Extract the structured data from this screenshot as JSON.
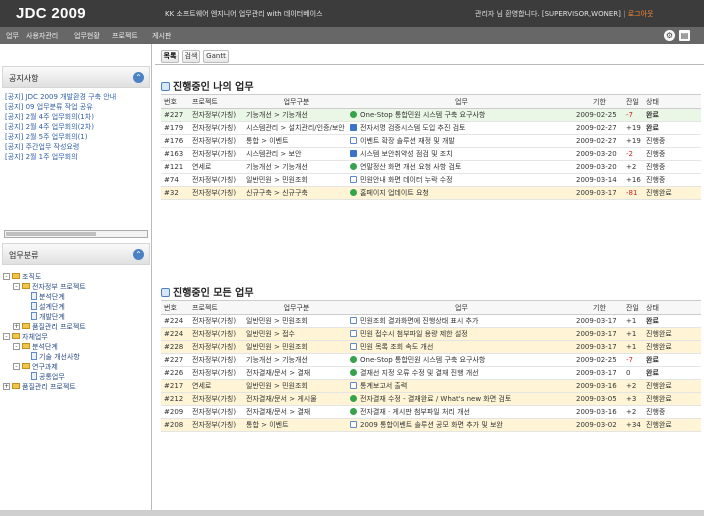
{
  "app": {
    "logo": "JDC 2009",
    "top_center": "KK 소프트웨어 엔지니어 업무관리 with 데이터베이스",
    "top_right_user": "관리자 님 환영합니다. [SUPERVISOR,WONER]",
    "top_right_link": "로그아웃"
  },
  "menu": {
    "items": [
      "업무",
      "사용자관리",
      "업무현황",
      "프로젝트",
      "게시판"
    ],
    "icons": [
      "gear-icon",
      "document-icon"
    ]
  },
  "sidebar": {
    "notice_title": "공지사항",
    "notices": [
      "[공지] JDC 2009 개발환경 구축 안내",
      "[공지] 09 업무분류 작업 공유",
      "[공지] 2월 4주 업무회의(1차)",
      "[공지] 2월 4주 업무회의(2차)",
      "[공지] 2월 5주 업무회의(1)",
      "[공지] 주간업무 작성요령",
      "[공지] 2월 1주 업무회의"
    ],
    "tree_title": "업무분류",
    "tree": [
      {
        "label": "조직도",
        "level": 0,
        "type": "folder"
      },
      {
        "label": "전자정부 프로젝트",
        "level": 1,
        "type": "folder"
      },
      {
        "label": "분석단계",
        "level": 2,
        "type": "doc"
      },
      {
        "label": "설계단계",
        "level": 2,
        "type": "doc"
      },
      {
        "label": "개발단계",
        "level": 2,
        "type": "doc"
      },
      {
        "label": "품질관리 프로젝트",
        "level": 1,
        "type": "folder"
      },
      {
        "label": "자체업무",
        "level": 0,
        "type": "folder"
      },
      {
        "label": "분석단계",
        "level": 1,
        "type": "folder"
      },
      {
        "label": "기술 개선사항",
        "level": 2,
        "type": "doc"
      },
      {
        "label": "연구과제",
        "level": 1,
        "type": "folder"
      },
      {
        "label": "공통업무",
        "level": 2,
        "type": "doc"
      },
      {
        "label": "품질관리 프로젝트",
        "level": 0,
        "type": "folder"
      }
    ]
  },
  "tabs": [
    "목록",
    "검색",
    "Gantt"
  ],
  "my_tasks": {
    "title": "진행중인 나의 업무",
    "columns": [
      "번호",
      "프로젝트",
      "업무구분",
      "업무",
      "기한",
      "잔일",
      "상태"
    ],
    "rows": [
      {
        "no": "#227",
        "project": "전자정부(가칭)",
        "part": "기능개선 > 기능개선",
        "part_color": "orange",
        "title": "One-Stop 통합민원 시스템 구축 요구사항",
        "icon": "green",
        "due": "2009-02-25",
        "left": "-7",
        "status": "완료",
        "status_kind": "done",
        "row": "green"
      },
      {
        "no": "#179",
        "project": "전자정부(가칭)",
        "part": "시스템관리 > 설치관리/인증/보안",
        "part_color": "red",
        "title": "전자서명 검증시스템 도입 추진 검토",
        "icon": "blue",
        "due": "2009-02-27",
        "left": "+19",
        "status": "완료",
        "status_kind": "done",
        "row": "white"
      },
      {
        "no": "#176",
        "project": "전자정부(가칭)",
        "part": "통합 > 이벤트",
        "part_color": "blue",
        "title": "이벤트 확장 솔루션 재정 및 개발",
        "icon": "doc",
        "due": "2009-02-27",
        "left": "+19",
        "status": "진행중",
        "status_kind": "prog",
        "row": "white"
      },
      {
        "no": "#163",
        "project": "전자정부(가칭)",
        "part": "시스템관리 > 보안",
        "part_color": "red",
        "title": "시스템 보안취약성 점검 및 조치",
        "icon": "blue",
        "due": "2009-03-20",
        "left": "-2",
        "status": "진행중",
        "status_kind": "prog",
        "row": "white"
      },
      {
        "no": "#121",
        "project": "연세로",
        "part": "기능개선 > 기능개선",
        "part_color": "orange",
        "title": "연말정산 화면 개선 요청 사항 검토",
        "icon": "green",
        "due": "2009-03-20",
        "left": "+2",
        "status": "진행중",
        "status_kind": "prog",
        "row": "white"
      },
      {
        "no": "#74",
        "project": "전자정부(가칭)",
        "part": "일반민원 > 민원조회",
        "part_color": "blue",
        "title": "민원안내 화면 데이터 누락 수정",
        "icon": "doc",
        "due": "2009-03-14",
        "left": "+16",
        "status": "진행중",
        "status_kind": "prog",
        "row": "white"
      },
      {
        "no": "#32",
        "project": "전자정부(가칭)",
        "part": "신규구축 > 신규구축",
        "part_color": "orange",
        "title": "홈페이지 업데이트 요청",
        "icon": "green",
        "due": "2009-03-17",
        "left": "-81",
        "status": "진행완료",
        "status_kind": "req",
        "row": "yellow"
      }
    ]
  },
  "recent_tasks": {
    "title": "진행중인 모든 업무",
    "columns": [
      "번호",
      "프로젝트",
      "업무구분",
      "업무",
      "기한",
      "잔일",
      "상태"
    ],
    "rows": [
      {
        "no": "#224",
        "project": "전자정부(가칭)",
        "part": "일반민원 > 민원조회",
        "part_color": "blue",
        "title": "민원조회 결과화면에 진행상태 표시 추가",
        "icon": "doc",
        "due": "2009-03-17",
        "left": "+1",
        "status": "완료",
        "status_kind": "done",
        "row": "white"
      },
      {
        "no": "#224",
        "project": "전자정부(가칭)",
        "part": "일반민원 > 접수",
        "part_color": "blue",
        "title": "민원 접수시 첨부파일 용량 제한 설정",
        "icon": "doc",
        "due": "2009-03-17",
        "left": "+1",
        "status": "진행완료",
        "status_kind": "req",
        "row": "yellow"
      },
      {
        "no": "#228",
        "project": "전자정부(가칭)",
        "part": "일반민원 > 민원조회",
        "part_color": "blue",
        "title": "민원 목록 조회 속도 개선",
        "icon": "doc",
        "due": "2009-03-17",
        "left": "+1",
        "status": "진행완료",
        "status_kind": "req",
        "row": "yellow"
      },
      {
        "no": "#227",
        "project": "전자정부(가칭)",
        "part": "기능개선 > 기능개선",
        "part_color": "orange",
        "title": "One-Stop 통합민원 시스템 구축 요구사항",
        "icon": "green",
        "due": "2009-02-25",
        "left": "-7",
        "status": "완료",
        "status_kind": "done",
        "row": "white"
      },
      {
        "no": "#226",
        "project": "전자정부(가칭)",
        "part": "전자결재/문서 > 결재",
        "part_color": "red",
        "title": "결재선 지정 오류 수정 및 결재 진행 개선",
        "icon": "green",
        "due": "2009-03-17",
        "left": "0",
        "status": "완료",
        "status_kind": "done",
        "row": "white"
      },
      {
        "no": "#217",
        "project": "연세로",
        "part": "일반민원 > 민원조회",
        "part_color": "blue",
        "title": "통계보고서 출력",
        "icon": "doc",
        "due": "2009-03-16",
        "left": "+2",
        "status": "진행완료",
        "status_kind": "req",
        "row": "yellow"
      },
      {
        "no": "#212",
        "project": "전자정부(가칭)",
        "part": "전자결재/문서 > 게시물",
        "part_color": "red",
        "title": "전자결재 수정 - 결재완료 / What's new 화면 검토",
        "icon": "green",
        "due": "2009-03-05",
        "left": "+3",
        "status": "진행완료",
        "status_kind": "req",
        "row": "yellow"
      },
      {
        "no": "#209",
        "project": "전자정부(가칭)",
        "part": "전자결재/문서 > 결재",
        "part_color": "red",
        "title": "전자결재 · 게시판 첨부파일 처리 개선",
        "icon": "green",
        "due": "2009-03-16",
        "left": "+2",
        "status": "진행중",
        "status_kind": "prog",
        "row": "white"
      },
      {
        "no": "#208",
        "project": "전자정부(가칭)",
        "part": "통합 > 이벤트",
        "part_color": "blue",
        "title": "2009 통합이벤트 솔루션 공모 화면 추가 및 보완",
        "icon": "doc",
        "due": "2009-03-02",
        "left": "+34",
        "status": "진행완료",
        "status_kind": "req",
        "row": "yellow"
      }
    ]
  }
}
